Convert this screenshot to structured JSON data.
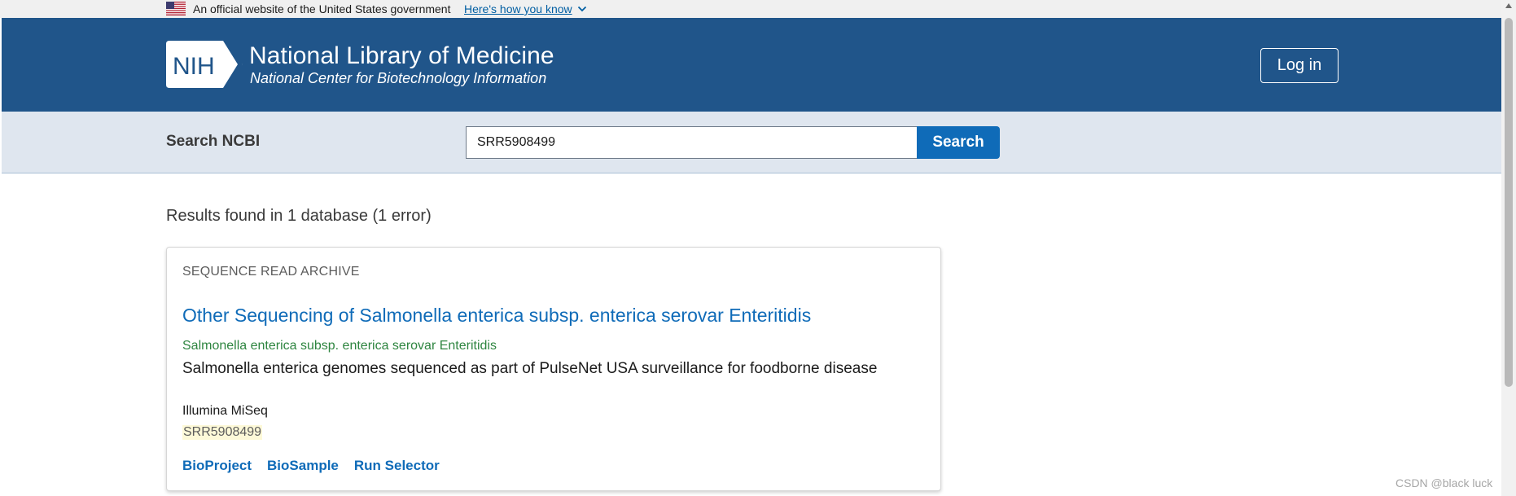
{
  "gov_banner": {
    "text": "An official website of the United States government",
    "link": "Here's how you know"
  },
  "header": {
    "logo_text": "NIH",
    "title": "National Library of Medicine",
    "subtitle": "National Center for Biotechnology Information",
    "login_label": "Log in"
  },
  "search": {
    "label": "Search NCBI",
    "value": "SRR5908499",
    "button_label": "Search"
  },
  "results": {
    "summary": "Results found in 1 database (1 error)",
    "card": {
      "database": "SEQUENCE READ ARCHIVE",
      "title": "Other Sequencing of Salmonella enterica subsp. enterica serovar Enteritidis",
      "organism": "Salmonella enterica subsp. enterica serovar Enteritidis",
      "description": "Salmonella enterica genomes sequenced as part of PulseNet USA surveillance for foodborne disease",
      "platform": "Illumina MiSeq",
      "accession": "SRR5908499",
      "links": [
        "BioProject",
        "BioSample",
        "Run Selector"
      ]
    }
  },
  "watermark": "CSDN @black luck",
  "colors": {
    "header_bg": "#20558a",
    "search_bar_bg": "#dfe6ef",
    "link_blue": "#0f6bb8",
    "organism_green": "#2e8540"
  },
  "icons": [
    "us-flag-icon",
    "chevron-down-icon",
    "nih-logo-icon"
  ]
}
